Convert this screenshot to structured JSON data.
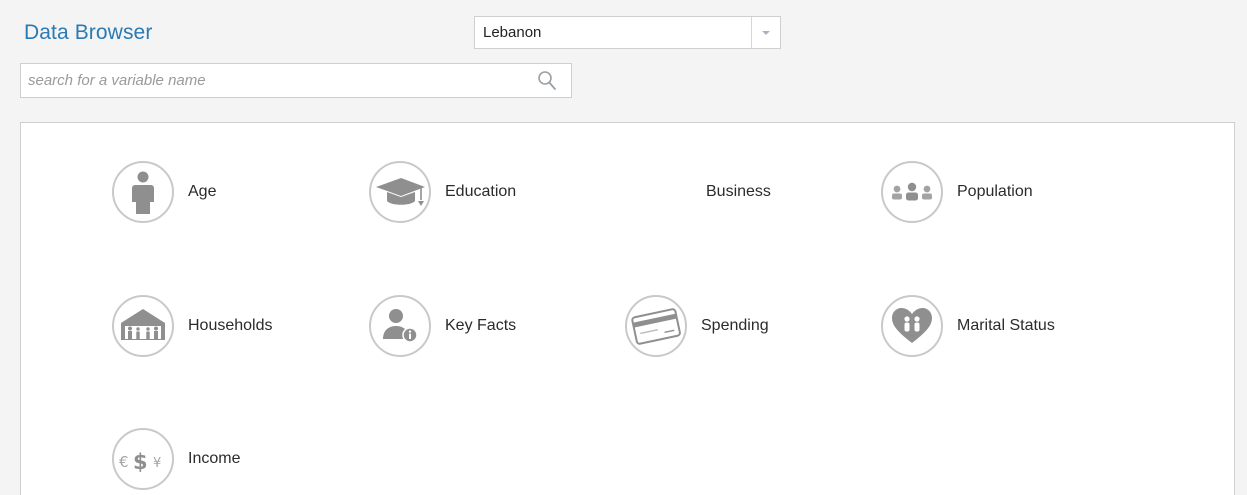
{
  "header": {
    "title": "Data Browser"
  },
  "country_select": {
    "value": "Lebanon"
  },
  "search": {
    "placeholder": "search for a variable name",
    "value": ""
  },
  "categories": [
    {
      "label": "Age",
      "icon": "person-icon"
    },
    {
      "label": "Education",
      "icon": "graduation-cap-icon"
    },
    {
      "label": "Business",
      "icon": ""
    },
    {
      "label": "Population",
      "icon": "people-group-icon"
    },
    {
      "label": "Households",
      "icon": "house-family-icon"
    },
    {
      "label": "Key Facts",
      "icon": "person-info-icon"
    },
    {
      "label": "Spending",
      "icon": "credit-card-icon"
    },
    {
      "label": "Marital Status",
      "icon": "heart-couple-icon"
    },
    {
      "label": "Income",
      "icon": "currency-icon"
    }
  ],
  "colors": {
    "title": "#2a7ab3",
    "icon_fill": "#8f8f8f",
    "icon_border": "#c9c9c9"
  }
}
